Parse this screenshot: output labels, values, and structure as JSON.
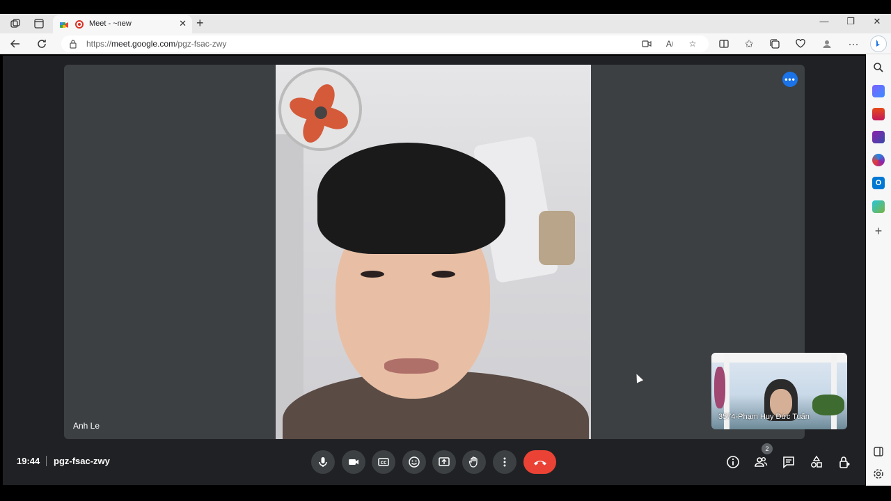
{
  "browser": {
    "tab": {
      "title": "Meet - ~new"
    },
    "url": {
      "scheme": "https://",
      "host": "meet.google.com",
      "path": "/pgz-fsac-zwy"
    }
  },
  "meet": {
    "main_participant": "Anh Le",
    "self_participant": "3574-Phạm Huy Đức Tuấn",
    "time": "19:44",
    "meeting_code": "pgz-fsac-zwy",
    "people_count": "2"
  },
  "colors": {
    "accent": "#1a73e8",
    "hangup": "#ea4335",
    "background": "#202124",
    "tile": "#3c4043"
  }
}
